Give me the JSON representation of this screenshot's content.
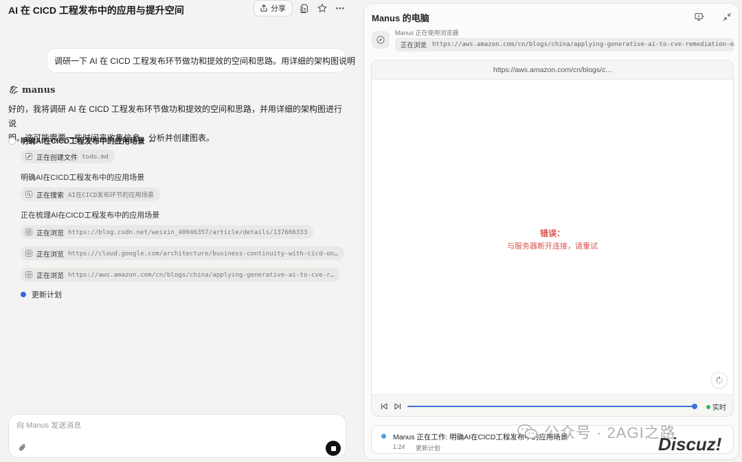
{
  "left": {
    "title": "AI 在 CICD 工程发布中的应用与提升空间",
    "share_label": "分享",
    "user_message": "调研一下 AI 在 CICD 工程发布环节做功和提效的空间和思路。用详细的架构图说明",
    "brand": "manus",
    "intro_line1": "好的，我将调研 AI 在 CICD 工程发布环节做功和提效的空间和思路，并用详细的架构图进行说",
    "intro_line2": "明。这可能需要一些时间来收集信息、分析并创建图表。",
    "step_title": "明确AI在CICD工程发布中的应用场景",
    "chips": [
      {
        "action": "正在创建文件",
        "detail": "todo.md",
        "icon": "file-edit-icon"
      },
      {
        "action": "正在搜索",
        "detail": "AI在CICD发布环节的应用场景",
        "icon": "search-icon"
      },
      {
        "action": "正在浏览",
        "detail": "https://blog.csdn.net/weixin_40046357/article/details/137666333",
        "icon": "compass-icon"
      },
      {
        "action": "正在浏览",
        "detail": "https://cloud.google.com/architecture/business-continuity-with-cicd-on…",
        "icon": "compass-icon"
      },
      {
        "action": "正在浏览",
        "detail": "https://aws.amazon.com/cn/blogs/china/applying-generative-ai-to-cve-r…",
        "icon": "compass-icon"
      }
    ],
    "notes": [
      "明确AI在CICD工程发布中的应用场景",
      "正在梳理AI在CICD工程发布中的应用场景"
    ],
    "update_plan": "更新计划",
    "composer_placeholder": "向 Manus 发送消息"
  },
  "right": {
    "title": "Manus 的电脑",
    "using_browser": "Manus 正在使用浏览器",
    "browsing_action": "正在浏览",
    "browsing_url": "https://aws.amazon.com/cn/blogs/china/applying-generative-ai-to-cve-remediation-ea…",
    "address": "https://aws.amazon.com/cn/blogs/c...",
    "error_title": "错误：",
    "error_message": "与服务器断开连接，请重试",
    "live_label": "实时",
    "progress": 0.99,
    "status_text": "Manus 正在工作: 明确AI在CICD工程发布中的应用场景",
    "status_time": "1:24",
    "status_step": "更新计划"
  },
  "watermarks": {
    "wechat": "公众号 · 2AGI之路",
    "discuz": "Discuz!"
  },
  "colors": {
    "accent_blue": "#3b73d9",
    "error_red": "#d9534f",
    "live_green": "#33b35a"
  }
}
